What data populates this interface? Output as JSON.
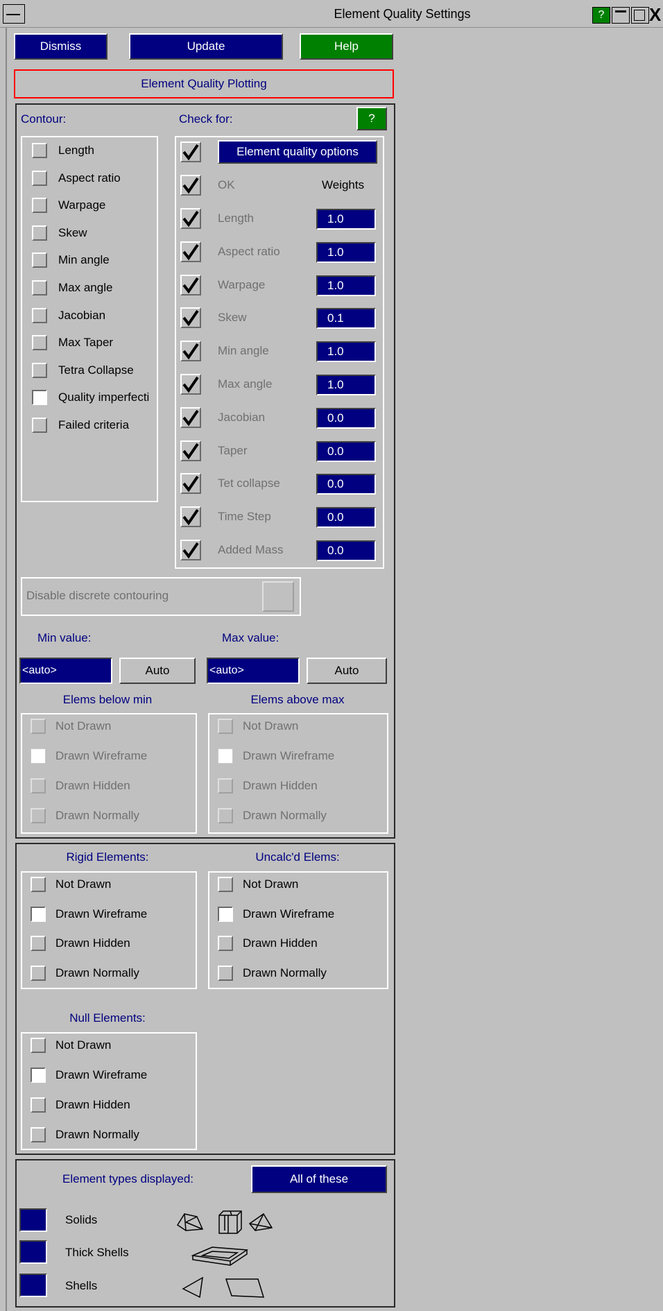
{
  "window": {
    "title": "Element Quality Settings",
    "help_glyph": "?",
    "close_glyph": "X"
  },
  "toolbar": {
    "dismiss": "Dismiss",
    "update": "Update",
    "help": "Help"
  },
  "header_label": "Element Quality Plotting",
  "contour": {
    "title": "Contour:",
    "items": [
      {
        "label": "Length",
        "checked": false
      },
      {
        "label": "Aspect ratio",
        "checked": false
      },
      {
        "label": "Warpage",
        "checked": false
      },
      {
        "label": "Skew",
        "checked": false
      },
      {
        "label": "Min angle",
        "checked": false
      },
      {
        "label": "Max angle",
        "checked": false
      },
      {
        "label": "Jacobian",
        "checked": false
      },
      {
        "label": "Max Taper",
        "checked": false
      },
      {
        "label": "Tetra Collapse",
        "checked": false
      },
      {
        "label": "Quality imperfecti",
        "checked": true
      },
      {
        "label": "Failed criteria",
        "checked": false
      }
    ]
  },
  "check_for": {
    "title": "Check for:",
    "help_glyph": "?",
    "options_button": "Element quality options",
    "ok_label": "OK",
    "weights_label": "Weights",
    "items": [
      {
        "label": "Length",
        "weight": "1.0"
      },
      {
        "label": "Aspect ratio",
        "weight": "1.0"
      },
      {
        "label": "Warpage",
        "weight": "1.0"
      },
      {
        "label": "Skew",
        "weight": "0.1"
      },
      {
        "label": "Min angle",
        "weight": "1.0"
      },
      {
        "label": "Max angle",
        "weight": "1.0"
      },
      {
        "label": "Jacobian",
        "weight": "0.0"
      },
      {
        "label": "Taper",
        "weight": "0.0"
      },
      {
        "label": "Tet collapse",
        "weight": "0.0"
      },
      {
        "label": "Time Step",
        "weight": "0.0"
      },
      {
        "label": "Added Mass",
        "weight": "0.0"
      }
    ]
  },
  "discrete": {
    "label": "Disable discrete contouring"
  },
  "range": {
    "min_label": "Min value:",
    "max_label": "Max value:",
    "min_value": "<auto>",
    "max_value": "<auto>",
    "auto_button": "Auto"
  },
  "below_min": {
    "title": "Elems below min",
    "options": [
      "Not Drawn",
      "Drawn Wireframe",
      "Drawn Hidden",
      "Drawn Normally"
    ],
    "selected": "Drawn Wireframe"
  },
  "above_max": {
    "title": "Elems above max",
    "options": [
      "Not Drawn",
      "Drawn Wireframe",
      "Drawn Hidden",
      "Drawn Normally"
    ],
    "selected": "Drawn Wireframe"
  },
  "rigid": {
    "title": "Rigid Elements:",
    "options": [
      "Not Drawn",
      "Drawn Wireframe",
      "Drawn Hidden",
      "Drawn Normally"
    ],
    "selected": "Drawn Wireframe"
  },
  "uncalcd": {
    "title": "Uncalc'd Elems:",
    "options": [
      "Not Drawn",
      "Drawn Wireframe",
      "Drawn Hidden",
      "Drawn Normally"
    ],
    "selected": "Drawn Wireframe"
  },
  "null_elems": {
    "title": "Null Elements:",
    "options": [
      "Not Drawn",
      "Drawn Wireframe",
      "Drawn Hidden",
      "Drawn Normally"
    ],
    "selected": "Drawn Wireframe"
  },
  "types": {
    "title": "Element types displayed:",
    "button": "All of these",
    "items": [
      {
        "label": "Solids",
        "icons": [
          "wedge-solid-icon",
          "hexa-solid-icon",
          "tetra-solid-icon"
        ]
      },
      {
        "label": "Thick Shells",
        "icons": [
          "thick-shell-icon"
        ]
      },
      {
        "label": "Shells",
        "icons": [
          "tria-shell-icon",
          "quad-shell-icon"
        ]
      }
    ]
  },
  "colors": {
    "navy": "#000080",
    "green": "#008000",
    "face": "#c0c0c0",
    "header_border": "#ff0000"
  }
}
